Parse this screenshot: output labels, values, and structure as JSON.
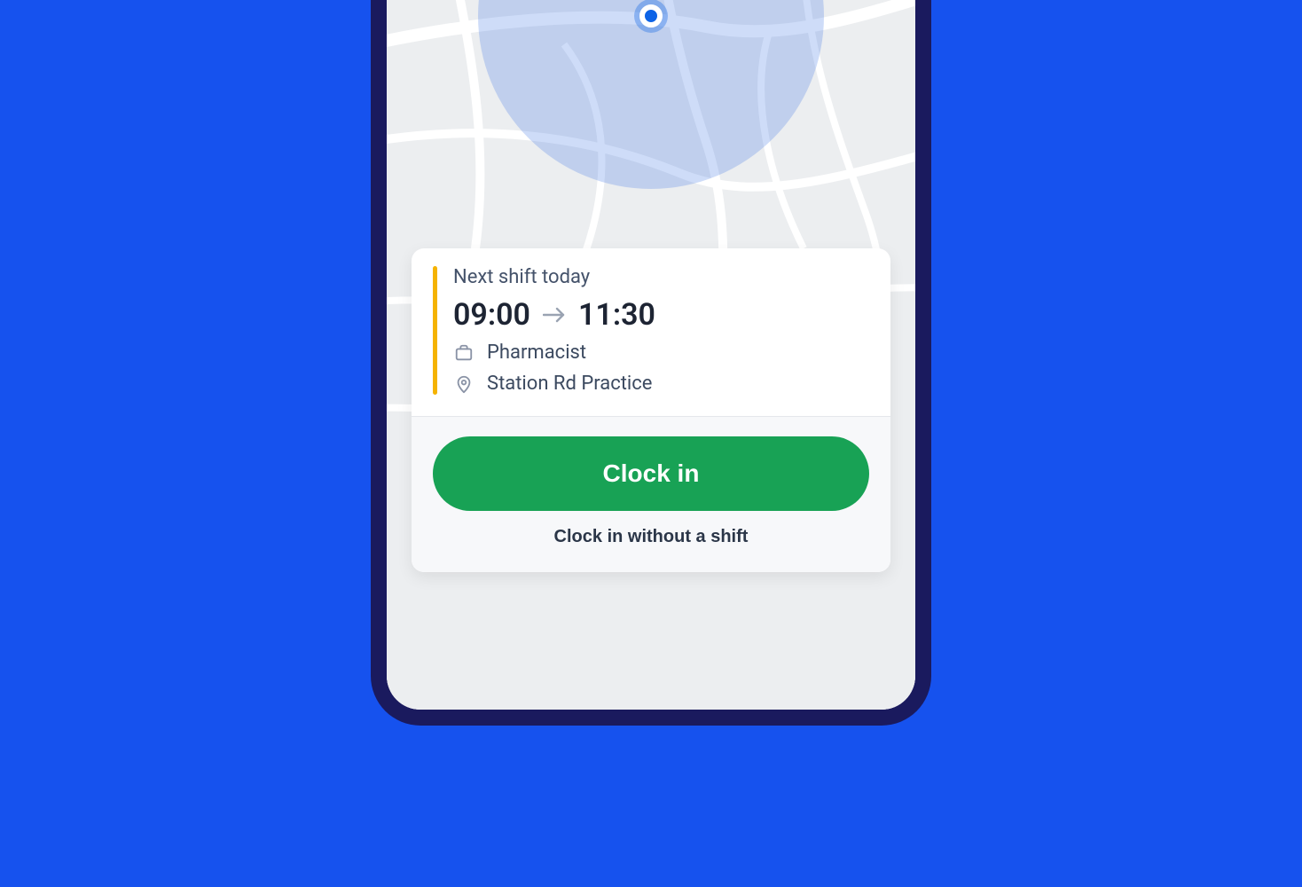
{
  "colors": {
    "accent_bar": "#f5b301",
    "primary_button": "#18a255"
  },
  "shift": {
    "label": "Next shift today",
    "start": "09:00",
    "end": "11:30",
    "role": "Pharmacist",
    "location": "Station Rd Practice"
  },
  "actions": {
    "clock_in": "Clock in",
    "clock_in_without_shift": "Clock in without a shift"
  }
}
